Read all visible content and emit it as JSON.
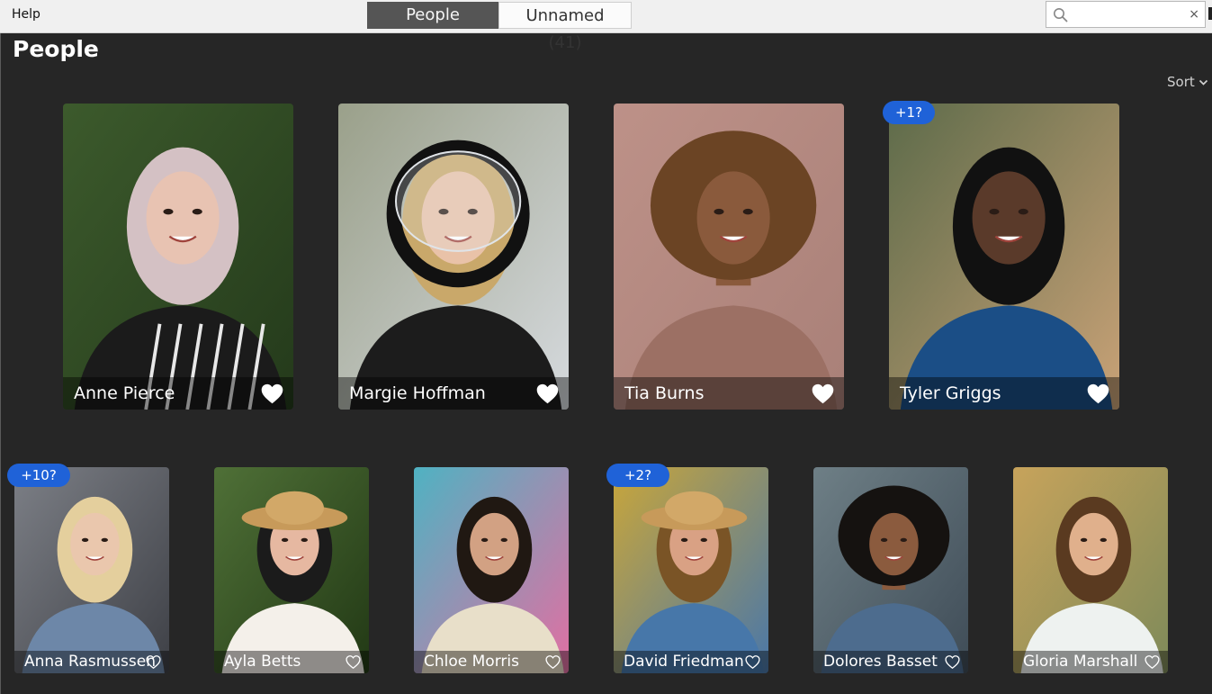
{
  "menu": {
    "help": "Help"
  },
  "tabs": [
    {
      "label": "People",
      "active": true
    },
    {
      "label": "Unnamed (41)",
      "active": false
    }
  ],
  "search": {
    "value": "",
    "placeholder": "",
    "clear_glyph": "×"
  },
  "page": {
    "title": "People"
  },
  "sort": {
    "label": "Sort"
  },
  "icons": {
    "search": "search-icon",
    "clear": "close-icon",
    "favorite": "heart-icon",
    "sort": "chevron-down-icon"
  },
  "colors": {
    "background": "#262626",
    "badge": "#1f62d8",
    "tab_active": "#555555"
  },
  "people": {
    "row1": [
      {
        "name": "Anne Pierce",
        "favorite": true,
        "badge": ""
      },
      {
        "name": "Margie Hoffman",
        "favorite": true,
        "badge": ""
      },
      {
        "name": "Tia Burns",
        "favorite": true,
        "badge": ""
      },
      {
        "name": "Tyler Griggs",
        "favorite": true,
        "badge": "+1?"
      }
    ],
    "row2": [
      {
        "name": "Anna Rasmussen",
        "favorite": false,
        "badge": "+10?"
      },
      {
        "name": "Ayla Betts",
        "favorite": false,
        "badge": ""
      },
      {
        "name": "Chloe Morris",
        "favorite": false,
        "badge": ""
      },
      {
        "name": "David Friedman",
        "favorite": false,
        "badge": "+2?"
      },
      {
        "name": "Dolores Basset",
        "favorite": false,
        "badge": ""
      },
      {
        "name": "Gloria Marshall",
        "favorite": false,
        "badge": ""
      }
    ]
  }
}
